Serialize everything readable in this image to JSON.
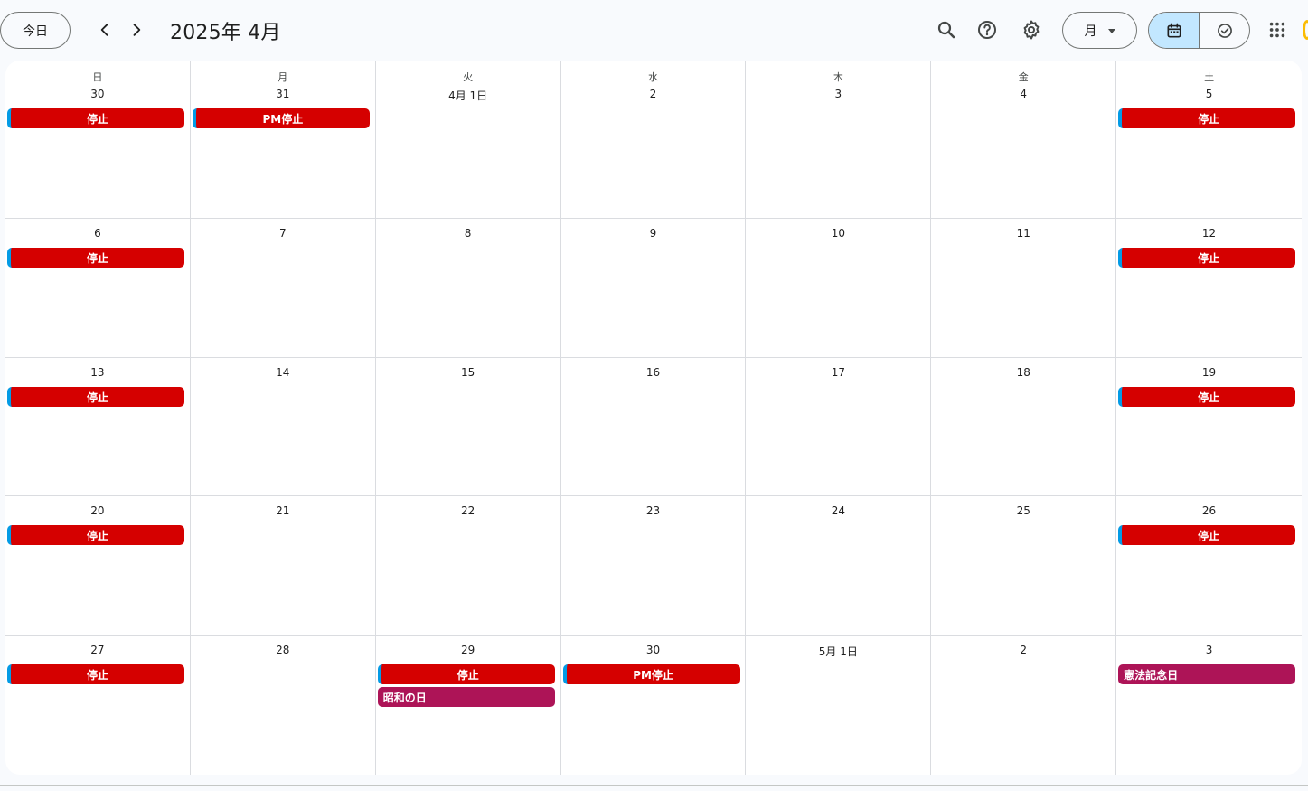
{
  "header": {
    "today_label": "今日",
    "prev_icon": "chevron-left-icon",
    "next_icon": "chevron-right-icon",
    "title": "2025年 4月",
    "view_label": "月",
    "icons": [
      "search-icon",
      "help-icon",
      "gear-icon",
      "calendar-icon",
      "task-check-icon",
      "apps-grid-icon"
    ]
  },
  "colors": {
    "event_red": "#d50000",
    "event_holiday": "#ad1457",
    "event_stripe": "#039be5",
    "toggle_active": "#c2e7ff"
  },
  "weekday_headers": [
    "日",
    "月",
    "火",
    "水",
    "木",
    "金",
    "土"
  ],
  "weeks": [
    {
      "days": [
        {
          "label": "30",
          "events": [
            {
              "title": "停止",
              "kind": "red",
              "stripe": true,
              "align": "center"
            }
          ]
        },
        {
          "label": "31",
          "events": [
            {
              "title": "PM停止",
              "kind": "red",
              "stripe": true,
              "align": "center"
            }
          ]
        },
        {
          "label": "4月 1日",
          "events": []
        },
        {
          "label": "2",
          "events": []
        },
        {
          "label": "3",
          "events": []
        },
        {
          "label": "4",
          "events": []
        },
        {
          "label": "5",
          "events": [
            {
              "title": "停止",
              "kind": "red",
              "stripe": true,
              "align": "center"
            }
          ]
        }
      ]
    },
    {
      "days": [
        {
          "label": "6",
          "events": [
            {
              "title": "停止",
              "kind": "red",
              "stripe": true,
              "align": "center"
            }
          ]
        },
        {
          "label": "7",
          "events": []
        },
        {
          "label": "8",
          "events": []
        },
        {
          "label": "9",
          "events": []
        },
        {
          "label": "10",
          "events": []
        },
        {
          "label": "11",
          "events": []
        },
        {
          "label": "12",
          "events": [
            {
              "title": "停止",
              "kind": "red",
              "stripe": true,
              "align": "center"
            }
          ]
        }
      ]
    },
    {
      "days": [
        {
          "label": "13",
          "events": [
            {
              "title": "停止",
              "kind": "red",
              "stripe": true,
              "align": "center"
            }
          ]
        },
        {
          "label": "14",
          "events": []
        },
        {
          "label": "15",
          "events": []
        },
        {
          "label": "16",
          "events": []
        },
        {
          "label": "17",
          "events": []
        },
        {
          "label": "18",
          "events": []
        },
        {
          "label": "19",
          "events": [
            {
              "title": "停止",
              "kind": "red",
              "stripe": true,
              "align": "center"
            }
          ]
        }
      ]
    },
    {
      "days": [
        {
          "label": "20",
          "events": [
            {
              "title": "停止",
              "kind": "red",
              "stripe": true,
              "align": "center"
            }
          ]
        },
        {
          "label": "21",
          "events": []
        },
        {
          "label": "22",
          "events": []
        },
        {
          "label": "23",
          "events": []
        },
        {
          "label": "24",
          "events": []
        },
        {
          "label": "25",
          "events": []
        },
        {
          "label": "26",
          "events": [
            {
              "title": "停止",
              "kind": "red",
              "stripe": true,
              "align": "center"
            }
          ]
        }
      ]
    },
    {
      "days": [
        {
          "label": "27",
          "events": [
            {
              "title": "停止",
              "kind": "red",
              "stripe": true,
              "align": "center"
            }
          ]
        },
        {
          "label": "28",
          "events": []
        },
        {
          "label": "29",
          "events": [
            {
              "title": "停止",
              "kind": "red",
              "stripe": true,
              "align": "center"
            },
            {
              "title": "昭和の日",
              "kind": "holiday",
              "stripe": false,
              "align": "left"
            }
          ]
        },
        {
          "label": "30",
          "events": [
            {
              "title": "PM停止",
              "kind": "red",
              "stripe": true,
              "align": "center"
            }
          ]
        },
        {
          "label": "5月 1日",
          "events": []
        },
        {
          "label": "2",
          "events": []
        },
        {
          "label": "3",
          "events": [
            {
              "title": "憲法記念日",
              "kind": "holiday",
              "stripe": false,
              "align": "left"
            }
          ]
        }
      ]
    }
  ]
}
